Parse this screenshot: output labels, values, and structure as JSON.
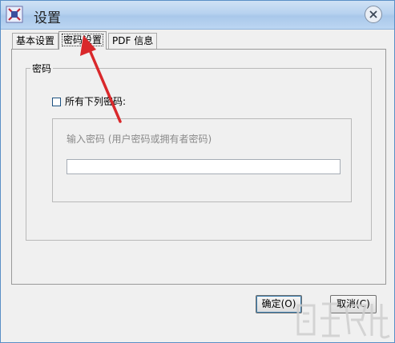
{
  "window": {
    "title": "设置",
    "close_glyph": "✕"
  },
  "tabs": [
    {
      "label": "基本设置",
      "active": false
    },
    {
      "label": "密码设置",
      "active": true
    },
    {
      "label": "PDF 信息",
      "active": false
    }
  ],
  "password_group": {
    "legend": "密码",
    "checkbox_label": "所有下列密码:",
    "checkbox_checked": false,
    "input_label": "输入密码 (用户密码或拥有者密码)",
    "input_value": ""
  },
  "buttons": {
    "ok_label": "确定(O)",
    "cancel_label": "取消(C)"
  },
  "annotation": {
    "arrow_color": "#d9282b"
  },
  "colors": {
    "titlebar": "#b7d2ef",
    "window_bg": "#f0f0f0"
  },
  "icons": {
    "app": "app-icon",
    "close": "close-icon"
  }
}
